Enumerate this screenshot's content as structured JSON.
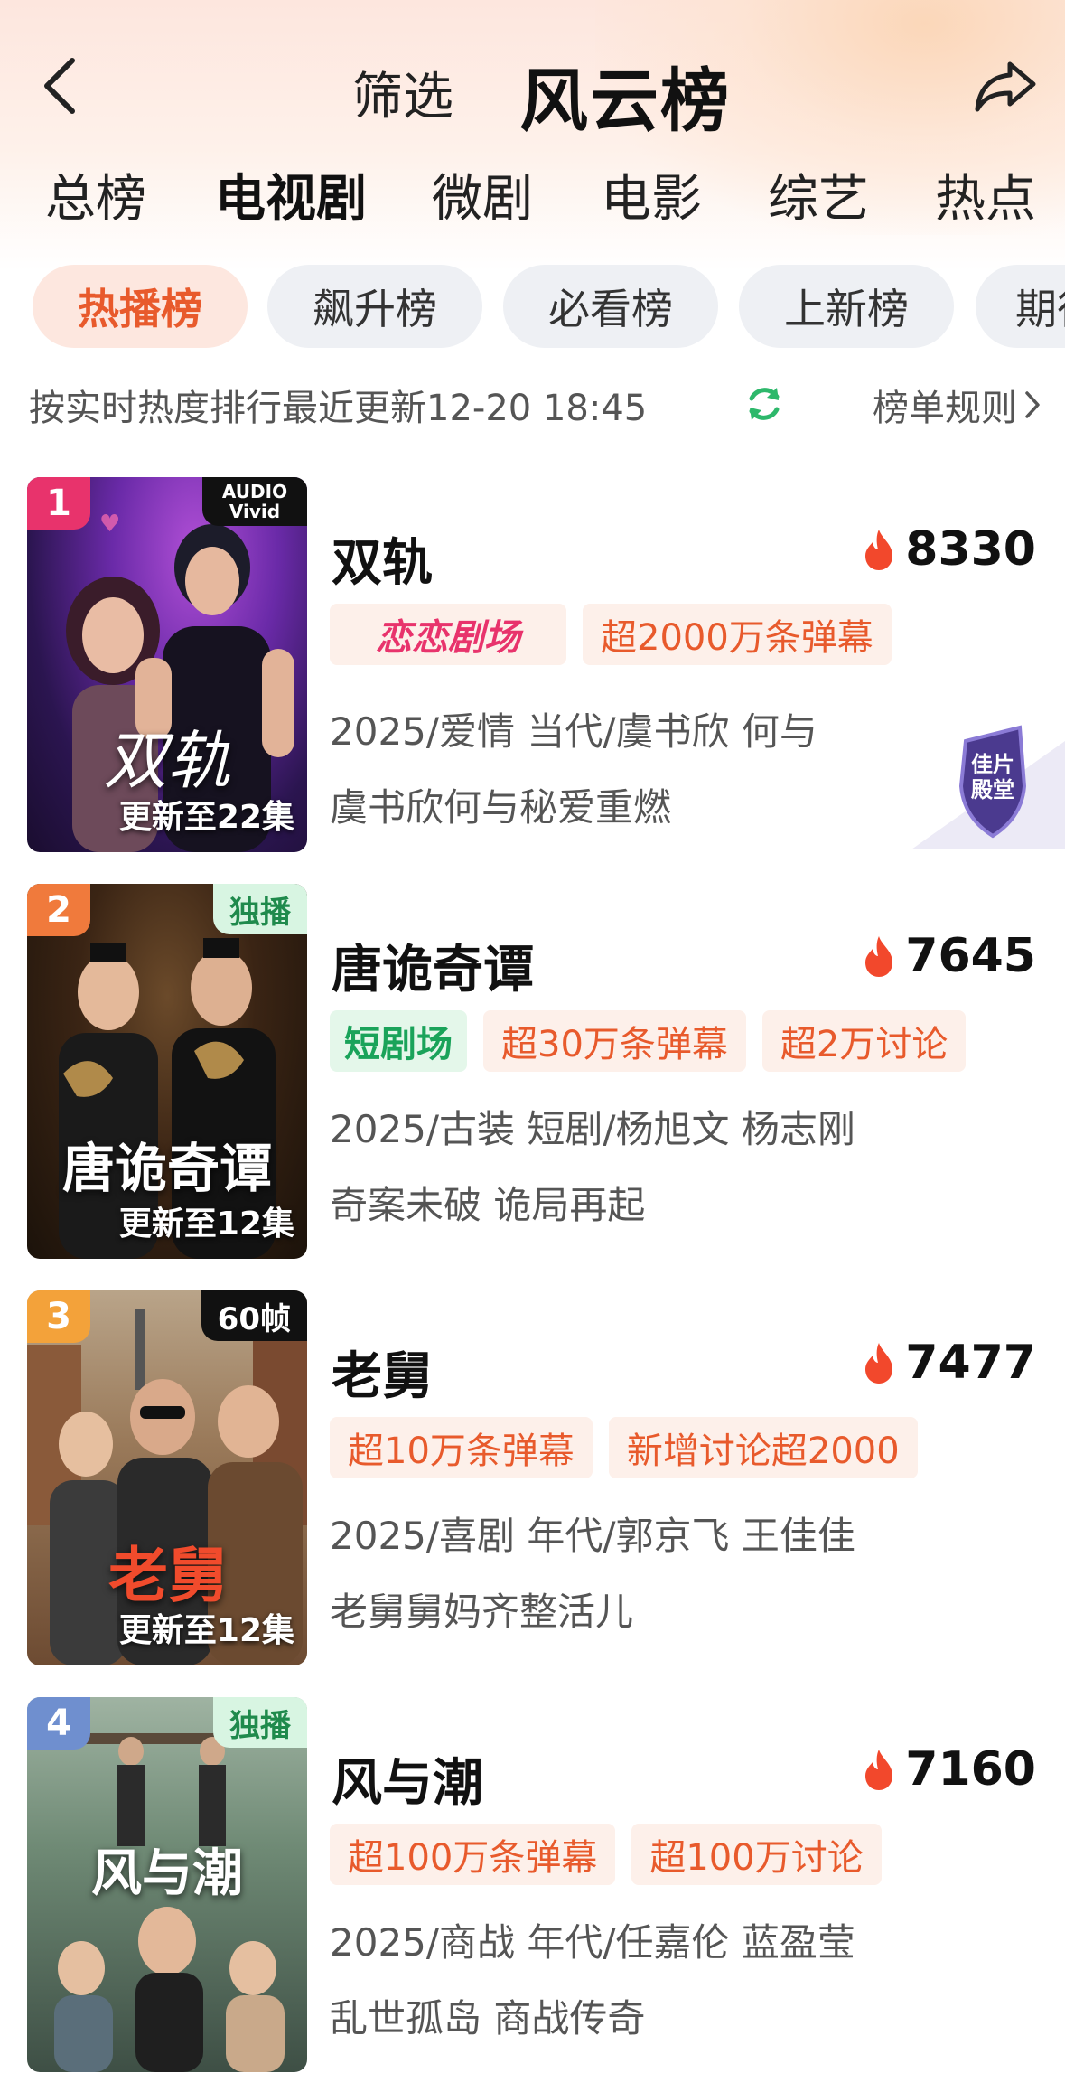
{
  "header": {
    "filter_label": "筛选",
    "title": "风云榜"
  },
  "category_tabs": [
    {
      "label": "总榜"
    },
    {
      "label": "电视剧"
    },
    {
      "label": "微剧"
    },
    {
      "label": "电影"
    },
    {
      "label": "综艺"
    },
    {
      "label": "热点"
    }
  ],
  "active_category": "电视剧",
  "sub_tabs": [
    {
      "label": "热播榜"
    },
    {
      "label": "飙升榜"
    },
    {
      "label": "必看榜"
    },
    {
      "label": "上新榜"
    },
    {
      "label": "期待榜"
    }
  ],
  "active_sub_tab": "热播榜",
  "info": {
    "text": "按实时热度排行最近更新12-20 18:45",
    "rules_label": "榜单规则"
  },
  "colors": {
    "accent": "#e85a2c",
    "tag_bg": "#fdf0ea",
    "rank1": "#e8336c",
    "rank2": "#f07a3c",
    "rank3": "#f3a23a",
    "rank4": "#6f8fcf",
    "refresh": "#2db86b"
  },
  "rankings": [
    {
      "rank": "1",
      "corner_tag": "AUDIO Vivid",
      "poster_art": "双轨",
      "poster_update": "更新至22集",
      "title": "双轨",
      "heat": "8330",
      "brand_tag": "恋恋剧场",
      "tags": [
        "超2000万条弹幕"
      ],
      "meta": "2025/爱情 当代/虞书欣 何与",
      "desc": "虞书欣何与秘爱重燃",
      "award": "佳片殿堂"
    },
    {
      "rank": "2",
      "corner_tag": "独播",
      "poster_art": "唐诡奇谭",
      "poster_update": "更新至12集",
      "title": "唐诡奇谭",
      "heat": "7645",
      "brand_tag": "短剧场",
      "tags": [
        "超30万条弹幕",
        "超2万讨论"
      ],
      "meta": "2025/古装 短剧/杨旭文 杨志刚",
      "desc": "奇案未破 诡局再起"
    },
    {
      "rank": "3",
      "corner_tag": "60帧",
      "poster_art": "老舅",
      "poster_update": "更新至12集",
      "title": "老舅",
      "heat": "7477",
      "tags": [
        "超10万条弹幕",
        "新增讨论超2000"
      ],
      "meta": "2025/喜剧 年代/郭京飞 王佳佳",
      "desc": "老舅舅妈齐整活儿"
    },
    {
      "rank": "4",
      "corner_tag": "独播",
      "poster_art": "风与潮",
      "title": "风与潮",
      "heat": "7160",
      "tags": [
        "超100万条弹幕",
        "超100万讨论"
      ],
      "meta": "2025/商战 年代/任嘉伦 蓝盈莹",
      "desc": "乱世孤岛 商战传奇"
    }
  ]
}
